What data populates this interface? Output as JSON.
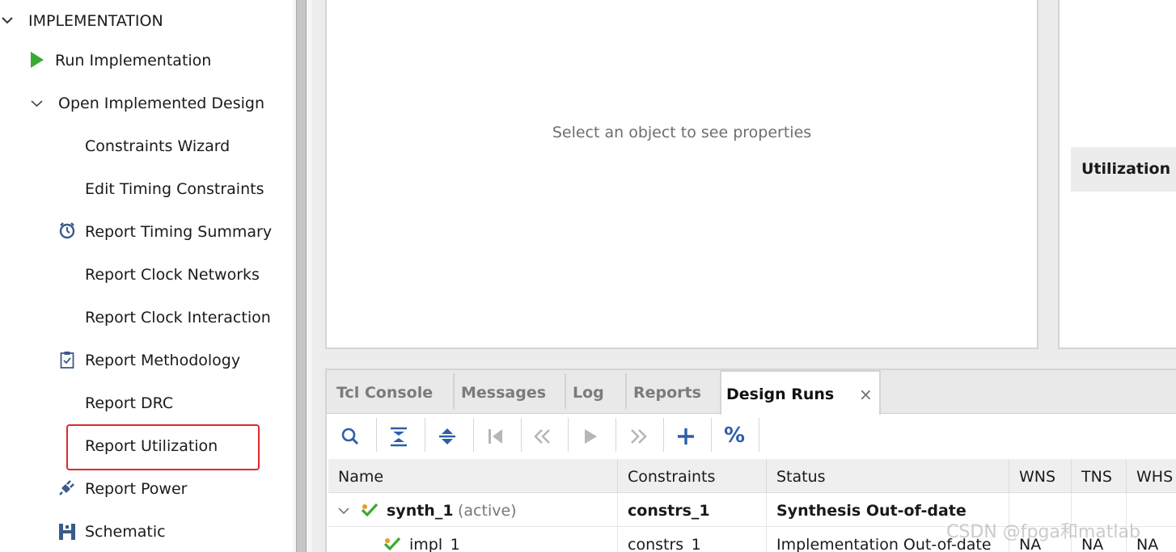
{
  "flow_nav": {
    "section_title": "IMPLEMENTATION",
    "items": [
      {
        "label": "Run Implementation"
      },
      {
        "label": "Open Implemented Design"
      },
      {
        "label": "Constraints Wizard"
      },
      {
        "label": "Edit Timing Constraints"
      },
      {
        "label": "Report Timing Summary"
      },
      {
        "label": "Report Clock Networks"
      },
      {
        "label": "Report Clock Interaction"
      },
      {
        "label": "Report Methodology"
      },
      {
        "label": "Report DRC"
      },
      {
        "label": "Report Utilization"
      },
      {
        "label": "Report Power"
      },
      {
        "label": "Schematic"
      }
    ],
    "highlight_color": "#e0262c"
  },
  "properties": {
    "empty_message": "Select an object to see properties"
  },
  "project_summary": {
    "utilization_header": "Utilization"
  },
  "bottom_panel": {
    "tabs": [
      {
        "label": "Tcl Console"
      },
      {
        "label": "Messages"
      },
      {
        "label": "Log"
      },
      {
        "label": "Reports"
      },
      {
        "label": "Design Runs",
        "active": true
      }
    ],
    "close_glyph": "×",
    "toolbar_icons": [
      "search-icon",
      "collapse-all-icon",
      "expand-all-icon",
      "first-icon",
      "rewind-icon",
      "play-icon",
      "fast-forward-icon",
      "add-icon",
      "percent-icon"
    ],
    "percent_glyph": "%",
    "table": {
      "columns": [
        "Name",
        "Constraints",
        "Status",
        "WNS",
        "TNS",
        "WHS"
      ],
      "rows": [
        {
          "name": "synth_1",
          "suffix": "(active)",
          "constraints": "constrs_1",
          "status": "Synthesis Out-of-date",
          "wns": "",
          "tns": "",
          "whs": ""
        },
        {
          "name": "impl_1",
          "suffix": "",
          "constraints": "constrs_1",
          "status": "Implementation Out-of-date",
          "wns": "NA",
          "tns": "NA",
          "whs": "NA"
        }
      ]
    }
  },
  "watermark": "CSDN @fpga和matlab",
  "colors": {
    "run_green": "#3aa935",
    "icon_blue": "#3c5a8a",
    "toolbar_blue": "#2d5fa8",
    "check_green": "#3aa935",
    "check_orange": "#f09a1a"
  }
}
